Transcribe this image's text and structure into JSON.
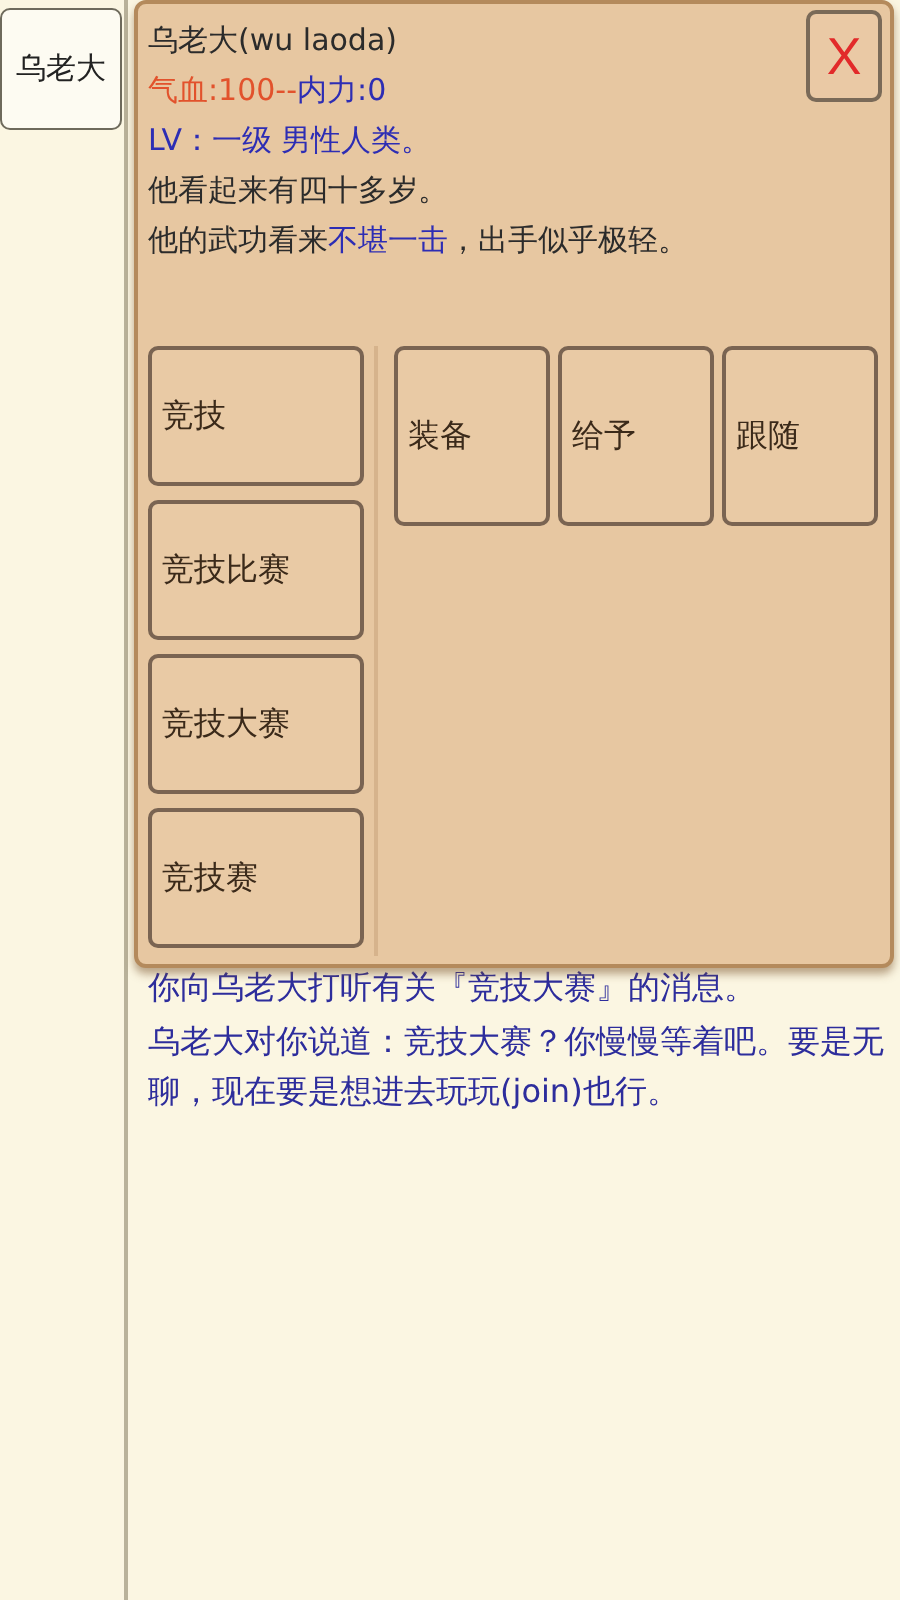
{
  "sidebar": {
    "items": [
      {
        "label": "乌老大",
        "selected": false
      }
    ]
  },
  "dialog": {
    "title": "乌老大(wu laoda)",
    "close": "X",
    "lines": [
      {
        "segments": [
          {
            "text": "气血:100--",
            "color": "#e2522c"
          },
          {
            "text": "内力:0",
            "color": "#2d2db4"
          }
        ]
      },
      {
        "segments": [
          {
            "text": "LV：一级  男性人类。",
            "color": "#2d2db4"
          }
        ]
      },
      {
        "segments": [
          {
            "text": "他看起来有四十多岁。",
            "color": "#2b2b2b"
          }
        ]
      },
      {
        "segments": [
          {
            "text": "他的武功看来",
            "color": "#2b2b2b"
          },
          {
            "text": "不堪一击",
            "color": "#2d2db4"
          },
          {
            "text": "，出手似乎极轻。",
            "color": "#2b2b2b"
          }
        ]
      }
    ],
    "left_actions": [
      "竞技",
      "竞技比赛",
      "竞技大赛",
      "竞技赛"
    ],
    "right_actions": [
      "装备",
      "给予",
      "跟随"
    ]
  },
  "log": [
    "你向乌老大打听有关『竞技大赛』的消息。",
    "乌老大对你说道：竞技大赛？你慢慢等着吧。要是无聊，现在要是想进去玩玩(join)也行。"
  ]
}
